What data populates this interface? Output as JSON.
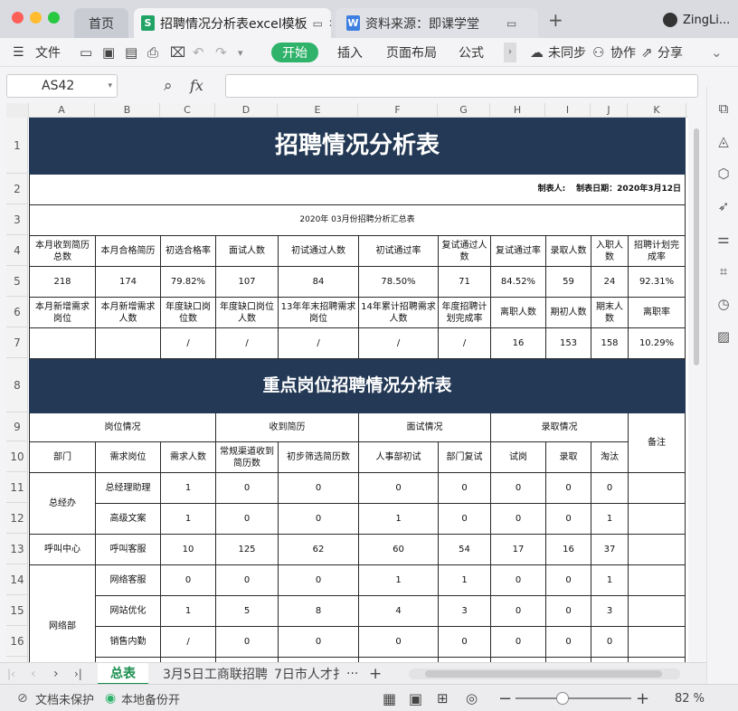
{
  "window": {
    "tabs": [
      {
        "label": "首页"
      },
      {
        "label": "招聘情况分析表excel模板"
      },
      {
        "label": "资料来源：即课学堂"
      }
    ],
    "new_tab": "+",
    "user": "ZingLi..."
  },
  "toolbar": {
    "menu": "文件",
    "start": "开始",
    "insert": "插入",
    "layout": "页面布局",
    "formula": "公式",
    "sync": "未同步",
    "collab": "协作",
    "share": "分享"
  },
  "formula_bar": {
    "cell_ref": "AS42",
    "fx": "fx",
    "value": ""
  },
  "columns": [
    "A",
    "B",
    "C",
    "D",
    "E",
    "F",
    "G",
    "H",
    "I",
    "J",
    "K"
  ],
  "rows": [
    "1",
    "2",
    "3",
    "4",
    "5",
    "6",
    "7",
    "8",
    "9",
    "10",
    "11",
    "12",
    "13",
    "14",
    "15",
    "16"
  ],
  "sheet": {
    "title": "招聘情况分析表",
    "maker_label": "制表人:",
    "date_label": "制表日期：2020年3月12日",
    "summary_title": "2020年 03月份招聘分析汇总表",
    "r4": [
      "本月收到简历总数",
      "本月合格简历",
      "初选合格率",
      "面试人数",
      "初试通过人数",
      "初试通过率",
      "复试通过人数",
      "复试通过率",
      "录取人数",
      "入职人数",
      "招聘计划完成率"
    ],
    "r5": [
      "218",
      "174",
      "79.82%",
      "107",
      "84",
      "78.50%",
      "71",
      "84.52%",
      "59",
      "24",
      "92.31%"
    ],
    "r6": [
      "本月新增需求岗位",
      "本月新增需求人数",
      "年度缺口岗位数",
      "年度缺口岗位人数",
      "13年年末招聘需求岗位",
      "14年累计招聘需求人数",
      "年度招聘计划完成率",
      "离职人数",
      "期初人数",
      "期末人数",
      "离职率"
    ],
    "r7": [
      "",
      "",
      "/",
      "/",
      "/",
      "/",
      "/",
      "16",
      "153",
      "158",
      "10.29%"
    ],
    "key_title": "重点岗位招聘情况分析表",
    "group_headers": [
      "岗位情况",
      "收到简历",
      "面试情况",
      "录取情况",
      "备注"
    ],
    "sub_headers": [
      "部门",
      "需求岗位",
      "需求人数",
      "常规渠道收到简历数",
      "初步筛选简历数",
      "人事部初试",
      "部门复试",
      "试岗",
      "录取",
      "淘汰"
    ],
    "departments": [
      "总经办",
      "呼叫中心",
      "网络部"
    ],
    "data": [
      [
        "总经理助理",
        "1",
        "0",
        "0",
        "0",
        "0",
        "0",
        "0",
        "0"
      ],
      [
        "高级文案",
        "1",
        "0",
        "0",
        "1",
        "0",
        "0",
        "0",
        "1"
      ],
      [
        "呼叫客服",
        "10",
        "125",
        "62",
        "60",
        "54",
        "17",
        "16",
        "37"
      ],
      [
        "网络客服",
        "0",
        "0",
        "0",
        "1",
        "1",
        "0",
        "0",
        "1"
      ],
      [
        "网站优化",
        "1",
        "5",
        "8",
        "4",
        "3",
        "0",
        "0",
        "3"
      ],
      [
        "销售内勤",
        "/",
        "0",
        "0",
        "0",
        "0",
        "0",
        "0",
        "0"
      ]
    ]
  },
  "sheet_tabs": [
    "总表",
    "3月5日工商联招聘",
    "7日市人才扌",
    "···",
    "+"
  ],
  "status": {
    "doc_protect": "文档未保护",
    "backup": "本地备份开",
    "zoom": "82 %"
  }
}
